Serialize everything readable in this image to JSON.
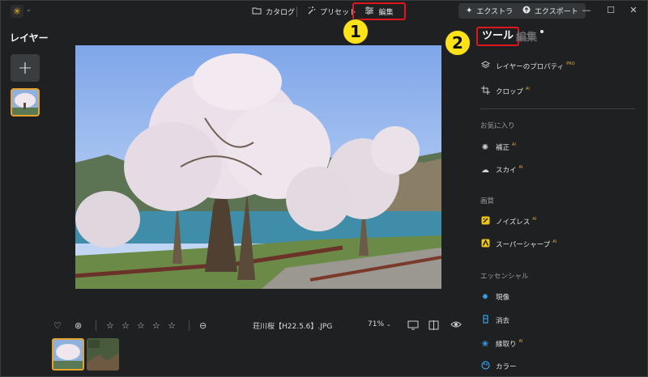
{
  "titlebar": {
    "nav": [
      {
        "id": "catalog",
        "label": "カタログ",
        "icon": "folder-icon"
      },
      {
        "id": "presets",
        "label": "プリセット",
        "icon": "magic-wand-icon"
      },
      {
        "id": "edit",
        "label": "編集",
        "icon": "sliders-icon"
      }
    ],
    "extra_label": "エクストラ",
    "export_label": "エクスポート",
    "window_controls": [
      "—",
      "☐",
      "✕"
    ]
  },
  "left_panel": {
    "title": "レイヤー",
    "add_symbol": "+"
  },
  "bottom_toolbar": {
    "filename": "荘川桜【H22.5.6】.JPG",
    "zoom": "71%",
    "rating_stars": 5
  },
  "right_panel": {
    "tabs": {
      "tools": "ツール",
      "edit": "編集"
    },
    "top_items": [
      {
        "label": "レイヤーのプロパティ",
        "badge": "PRO",
        "icon": "layers-icon"
      },
      {
        "label": "クロップ",
        "badge": "AI",
        "icon": "crop-icon"
      }
    ],
    "sections": [
      {
        "title": "お気に入り",
        "items": [
          {
            "label": "補正",
            "badge": "AI",
            "icon": "sparkle-icon"
          },
          {
            "label": "スカイ",
            "badge": "AI",
            "icon": "cloud-icon"
          }
        ]
      },
      {
        "title": "画質",
        "items": [
          {
            "label": "ノイズレス",
            "badge": "AI",
            "icon": "noiseless-icon"
          },
          {
            "label": "スーパーシャープ",
            "badge": "AI",
            "icon": "sharpen-icon"
          }
        ]
      },
      {
        "title": "エッセンシャル",
        "items": [
          {
            "label": "現像",
            "badge": "",
            "icon": "sun-icon"
          },
          {
            "label": "消去",
            "badge": "",
            "icon": "eraser-icon"
          },
          {
            "label": "縁取り",
            "badge": "AI",
            "icon": "frame-flower-icon"
          },
          {
            "label": "カラー",
            "badge": "",
            "icon": "color-palette-icon"
          }
        ]
      }
    ]
  },
  "callouts": [
    "1",
    "2"
  ],
  "colors": {
    "background": "#1e2021",
    "accent_highlight": "#e0161e",
    "callout": "#fde21a",
    "selection": "#e6a22a"
  }
}
